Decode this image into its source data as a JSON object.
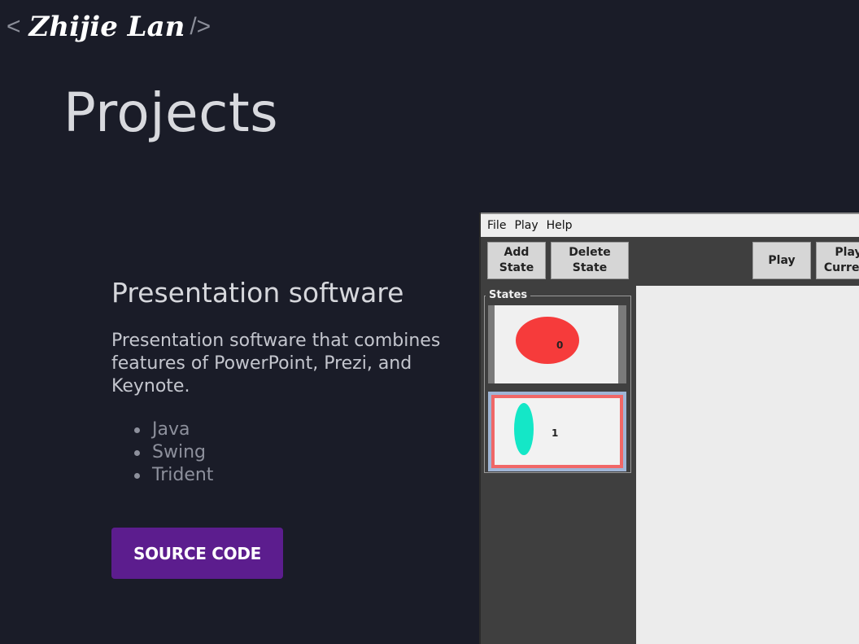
{
  "logo": {
    "open_bracket": "<",
    "name": "Zhijie Lan",
    "close_bracket": "/>"
  },
  "page_title": "Projects",
  "project": {
    "title": "Presentation software",
    "description": "Presentation software that combines features of PowerPoint, Prezi, and Keynote.",
    "tech": [
      "Java",
      "Swing",
      "Trident"
    ],
    "source_button": "SOURCE CODE"
  },
  "app_screenshot": {
    "menu": [
      "File",
      "Play",
      "Help"
    ],
    "toolbar": {
      "add_state": "Add\nState",
      "delete_state": "Delete\nState",
      "play": "Play",
      "play_current": "Play\nCurrent"
    },
    "states_label": "States",
    "states": [
      {
        "number": "0",
        "shape_color": "#f63b3b"
      },
      {
        "number": "1",
        "shape_color": "#14e7c7"
      }
    ],
    "selected_state_border": "#f06767"
  },
  "colors": {
    "background": "#1a1c28",
    "button": "#5c1d8e"
  }
}
